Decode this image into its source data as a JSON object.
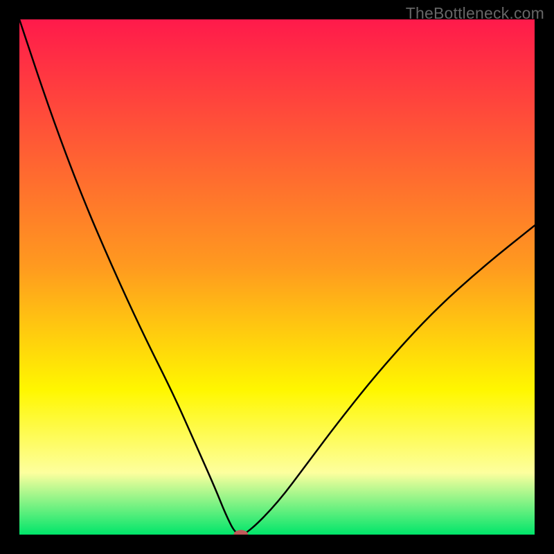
{
  "watermark": "TheBottleneck.com",
  "chart_data": {
    "type": "line",
    "title": "",
    "xlabel": "",
    "ylabel": "",
    "xlim": [
      0,
      100
    ],
    "ylim": [
      0,
      100
    ],
    "background_gradient_top_color": "#ff1a4b",
    "background_gradient_mid_color": "#fff700",
    "background_gradient_bottom_color": "#00e56a",
    "series": [
      {
        "name": "curve",
        "x": [
          0,
          6,
          12,
          18,
          24,
          30,
          34,
          38,
          40,
          42,
          44,
          50,
          56,
          62,
          70,
          80,
          90,
          100
        ],
        "y": [
          100,
          82,
          66,
          52,
          39,
          27,
          18,
          9,
          4,
          0,
          0,
          6,
          14,
          22,
          32,
          43,
          52,
          60
        ]
      }
    ],
    "marker": {
      "x": 43,
      "y": 0,
      "color": "#c05a5a",
      "rx": 1.4,
      "ry": 0.9
    },
    "grid": false,
    "legend": false
  }
}
